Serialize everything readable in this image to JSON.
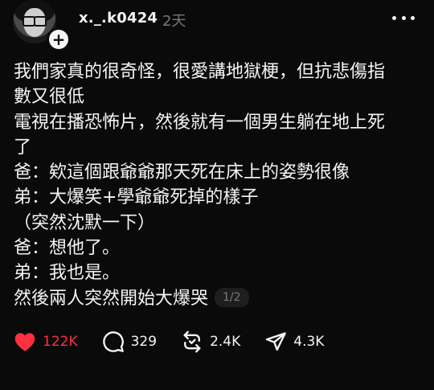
{
  "post": {
    "username": "x._.k0424",
    "timestamp": "2天",
    "lines": [
      "我們家真的很奇怪，很愛講地獄梗，但抗悲傷指",
      "數又很低",
      "電視在播恐怖片，然後就有一個男生躺在地上死",
      "了",
      "爸：欸這個跟爺爺那天死在床上的姿勢很像",
      "弟：大爆笑+學爺爺死掉的樣子",
      "（突然沈默一下）",
      "爸：想他了。",
      "弟：我也是。",
      "然後兩人突然開始大爆哭"
    ],
    "page_indicator": "1/2"
  },
  "actions": {
    "likes": "122K",
    "comments": "329",
    "reposts": "2.4K",
    "shares": "4.3K"
  },
  "colors": {
    "background": "#0a0a0a",
    "text": "#f3f5f7",
    "muted": "#777777",
    "like_red": "#ff3040"
  },
  "icons": {
    "avatar": "avatar",
    "follow": "plus-icon",
    "more": "more-icon",
    "like": "heart-icon",
    "comment": "comment-icon",
    "repost": "repost-icon",
    "share": "share-icon"
  }
}
